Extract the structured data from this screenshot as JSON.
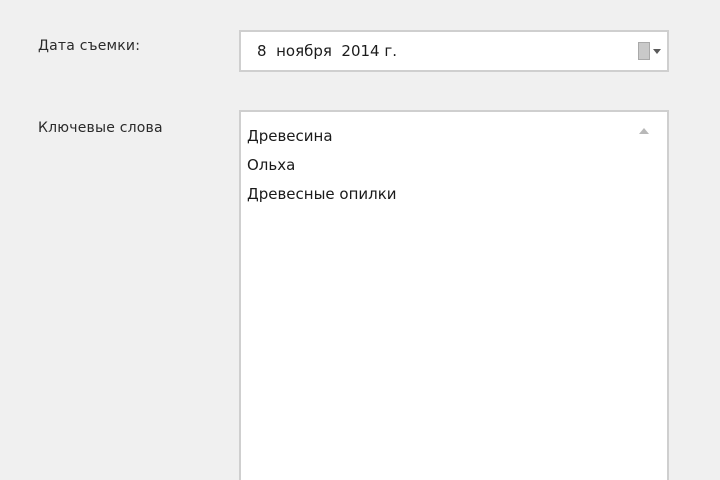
{
  "form": {
    "date_label": "Дата съемки:",
    "date_value": "8  ноября  2014 г.",
    "keywords_label": "Ключевые слова",
    "keywords": [
      "Древесина",
      "Ольха",
      "Древесные опилки"
    ]
  },
  "icons": {
    "calendar": "calendar-icon",
    "dropdown": "chevron-down-icon",
    "scroll_up": "scroll-up-icon"
  },
  "colors": {
    "background": "#f0f0f0",
    "field_background": "#ffffff",
    "field_border": "#cfcfcf"
  }
}
